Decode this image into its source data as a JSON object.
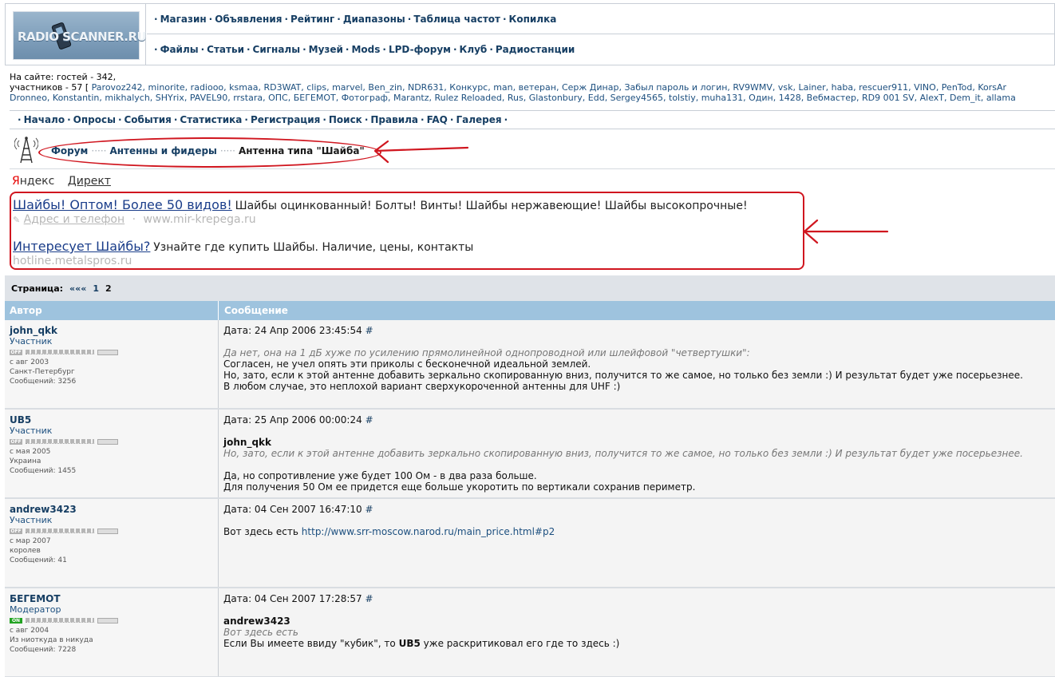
{
  "header": {
    "logo_text": "RADIO SCANNER.RU",
    "nav_row1": [
      "Магазин",
      "Объявления",
      "Рейтинг",
      "Диапазоны",
      "Таблица частот",
      "Копилка"
    ],
    "nav_row2": [
      "Файлы",
      "Статьи",
      "Сигналы",
      "Музей",
      "Mods",
      "LPD-форум",
      "Клуб",
      "Радиостанции"
    ]
  },
  "online": {
    "line1": "На сайте: гостей - 342,",
    "line2_prefix": "участников - 57 [",
    "users_line1": "Parovoz242, minorite, radiooo, ksmaa, RD3WAT, clips, marvel, Ben_zin, NDR631, Конкурс, man, ветеран, Серж Динар, Забыл пароль и логин, RV9WMV, vsk, Lainer, haba, rescuer911, VINO, PenTod, KorsAr",
    "users_line2": "Dronneo, Konstantin, mikhalych, SHYrix, PAVEL90, rrstara, ОПС, БЕГЕМОТ, Фотограф, Marantz, Rulez Reloaded, Rus, Glastonbury, Edd, Sergey4565, tolstiy, muha131, Один, 1428, Вебмастер, RD9 001 SV, AlexT, Dem_it, allama"
  },
  "menu": [
    "Начало",
    "Опросы",
    "События",
    "Статистика",
    "Регистрация",
    "Поиск",
    "Правила",
    "FAQ",
    "Галерея"
  ],
  "breadcrumb": {
    "forum": "Форум",
    "section": "Антенны и фидеры",
    "topic": "Антенна типа \"Шайба\""
  },
  "yandex": {
    "brand_first": "Я",
    "brand_rest": "ндекс",
    "direct": "Директ"
  },
  "ads": [
    {
      "title": "Шайбы! Оптом! Более 50 видов!",
      "text": "Шайбы оцинкованный! Болты! Винты! Шайбы нержавеющие! Шайбы высокопрочные!",
      "sub_link": "Адрес и телефон",
      "sub_sep": "·",
      "sub_url": "www.mir-krepega.ru"
    },
    {
      "title": "Интересует Шайбы?",
      "text": "Узнайте где купить Шайбы. Наличие, цены, контакты",
      "sub_url": "hotline.metalspros.ru"
    }
  ],
  "pager": {
    "label": "Страница:",
    "first": "«««",
    "page1": "1",
    "page2": "2"
  },
  "table": {
    "col_author": "Автор",
    "col_message": "Сообщение"
  },
  "posts": [
    {
      "author": "john_qkk",
      "role": "Участник",
      "status": "OFF",
      "since": "с авг 2003",
      "location": "Санкт-Петербург",
      "messages": "Сообщений: 3256",
      "date": "Дата: 24 Апр 2006 23:45:54",
      "hash": "#",
      "quote": "Да нет, она на 1 дБ хуже по усилению прямолинейной однопроводной или шлейфовой \"четвертушки\":",
      "body1": "Согласен, не учел опять эти приколы с бесконечной идеальной землей.",
      "body2": "Но, зато, если к этой антенне добавить зеркально скопированную вниз, получится то же самое, но только без земли :) И результат будет уже посерьезнее.",
      "body3": "В любом случае, это неплохой вариант сверхукороченной антенны для UHF :)"
    },
    {
      "author": "UB5",
      "role": "Участник",
      "status": "OFF",
      "since": "с мая 2005",
      "location": "Украина",
      "messages": "Сообщений: 1455",
      "date": "Дата: 25 Апр 2006 00:00:24",
      "hash": "#",
      "quote_src": "john_qkk",
      "quote": "Но, зато, если к этой антенне добавить зеркально скопированную вниз, получится то же самое, но только без земли :) И результат будет уже посерьезнее.",
      "body1": "Да, но сопротивление уже будет 100 Ом - в два раза больше.",
      "body2": "Для получения 50 Ом ее придется еще больше укоротить по вертикали сохранив периметр."
    },
    {
      "author": "andrew3423",
      "role": "Участник",
      "status": "OFF",
      "since": "с мар 2007",
      "location": "королев",
      "messages": "Сообщений: 41",
      "date": "Дата: 04 Сен 2007 16:47:10",
      "hash": "#",
      "body_prefix": "Вот здесь есть",
      "link": "http://www.srr-moscow.narod.ru/main_price.html#p2"
    },
    {
      "author": "БЕГЕМОТ",
      "role": "Модератор",
      "status": "ON",
      "since": "с авг 2004",
      "location": "Из ниоткуда в никуда",
      "messages": "Сообщений: 7228",
      "date": "Дата: 04 Сен 2007 17:28:57",
      "hash": "#",
      "quote_src": "andrew3423",
      "quote": "Вот здесь есть",
      "body_a": "Если Вы имеете ввиду \"кубик\", то",
      "body_bold": "UB5",
      "body_b": "уже раскритиковал его где то здесь :)"
    }
  ],
  "colors": {
    "link": "#163e63",
    "table_header": "#9ec3de",
    "annotation": "#d0161f",
    "ad_link": "#1a3d8a",
    "online_on": "#23a322"
  }
}
